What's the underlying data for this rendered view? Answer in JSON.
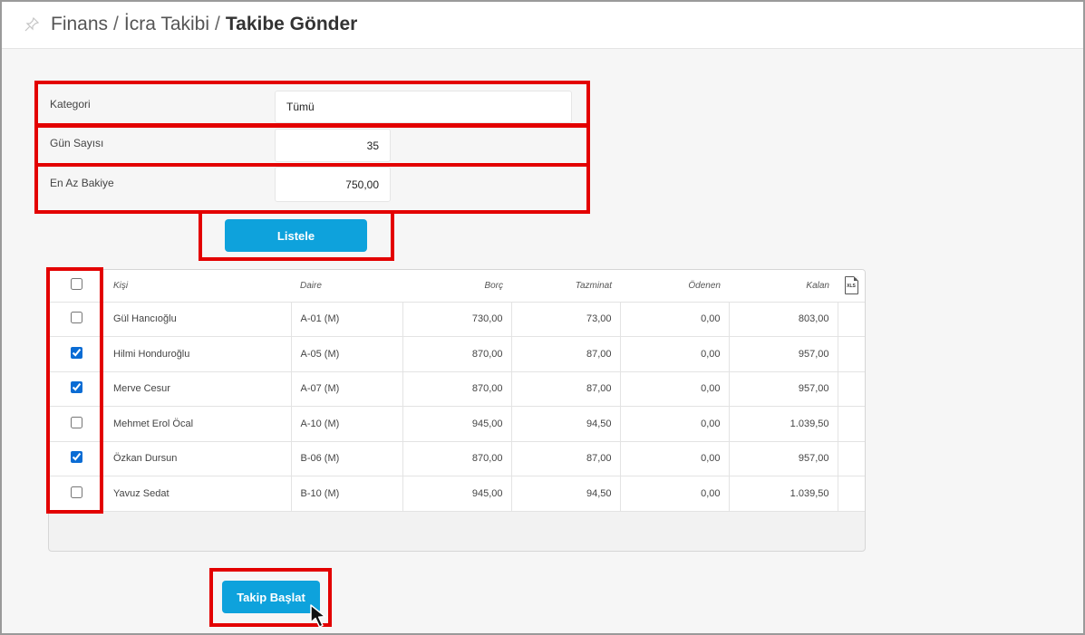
{
  "header": {
    "breadcrumb": [
      "Finans",
      "İcra Takibi"
    ],
    "separator": "/",
    "current": "Takibe Gönder",
    "pin_icon": "pin-icon"
  },
  "form": {
    "kategori_label": "Kategori",
    "kategori_value": "Tümü",
    "gun_sayisi_label": "Gün Sayısı",
    "gun_sayisi_value": "35",
    "en_az_bakiye_label": "En Az Bakiye",
    "en_az_bakiye_value": "750,00",
    "list_button": "Listele"
  },
  "table": {
    "columns": [
      "Kişi",
      "Daire",
      "Borç",
      "Tazminat",
      "Ödenen",
      "Kalan"
    ],
    "export_icon": "xls-icon",
    "export_label": "XLS",
    "header_checked": false,
    "rows": [
      {
        "checked": false,
        "kisi": "Gül Hancıoğlu",
        "daire": "A-01 (M)",
        "borc": "730,00",
        "tazminat": "73,00",
        "odenen": "0,00",
        "kalan": "803,00"
      },
      {
        "checked": true,
        "kisi": "Hilmi Honduroğlu",
        "daire": "A-05 (M)",
        "borc": "870,00",
        "tazminat": "87,00",
        "odenen": "0,00",
        "kalan": "957,00"
      },
      {
        "checked": true,
        "kisi": "Merve Cesur",
        "daire": "A-07 (M)",
        "borc": "870,00",
        "tazminat": "87,00",
        "odenen": "0,00",
        "kalan": "957,00"
      },
      {
        "checked": false,
        "kisi": "Mehmet Erol Öcal",
        "daire": "A-10 (M)",
        "borc": "945,00",
        "tazminat": "94,50",
        "odenen": "0,00",
        "kalan": "1.039,50"
      },
      {
        "checked": true,
        "kisi": "Özkan Dursun",
        "daire": "B-06 (M)",
        "borc": "870,00",
        "tazminat": "87,00",
        "odenen": "0,00",
        "kalan": "957,00"
      },
      {
        "checked": false,
        "kisi": "Yavuz Sedat",
        "daire": "B-10 (M)",
        "borc": "945,00",
        "tazminat": "94,50",
        "odenen": "0,00",
        "kalan": "1.039,50"
      }
    ]
  },
  "actions": {
    "start_button": "Takip Başlat",
    "cursor_icon": "mouse-pointer-icon"
  },
  "colors": {
    "accent": "#0ea2dc",
    "highlight": "#e30000"
  }
}
